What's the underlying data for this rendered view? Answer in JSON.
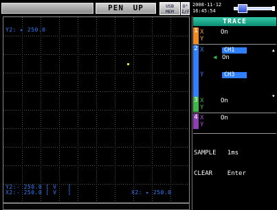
{
  "status_bar": {
    "mode_primary": "PEN",
    "mode_secondary": "UP",
    "usb_label": "USB",
    "mem_label": "MEM",
    "flag_top": "Oᴬ",
    "flag_bottom": "I/F",
    "date": "2008-11-12",
    "time": "16:45:54",
    "battery_level": 0.1
  },
  "plot": {
    "top_label": "Y2: ▸ 250.0",
    "bottom_label_1": "Y2:- 250.0 [ V   ]",
    "bottom_label_2": "X2:- 250.0 [ V   ]",
    "bottom_label_right": "X2: ▸ 250.0",
    "marker_color": "#f0e020",
    "grid_color": "#5a5a5a"
  },
  "trace_panel": {
    "title": "TRACE",
    "traces": [
      {
        "number": "1",
        "color": "#f08a20",
        "x_label": "X",
        "x_value": "On",
        "y_label": "Y"
      },
      {
        "number": "2",
        "color": "#2f7fff",
        "x_label": "X",
        "x_channel": "CH1",
        "x_value": "On",
        "y_label": "Y",
        "y_channel": "CH3"
      },
      {
        "number": "3",
        "color": "#3fb84a",
        "x_label": "X",
        "x_value": "On",
        "y_label": "Y"
      },
      {
        "number": "4",
        "color": "#8e3fb8",
        "x_label": "X",
        "x_value": "On",
        "y_label": "Y"
      }
    ],
    "sample_label": "SAMPLE",
    "sample_value": "1ms",
    "clear_label": "CLEAR",
    "clear_value": "Enter"
  }
}
